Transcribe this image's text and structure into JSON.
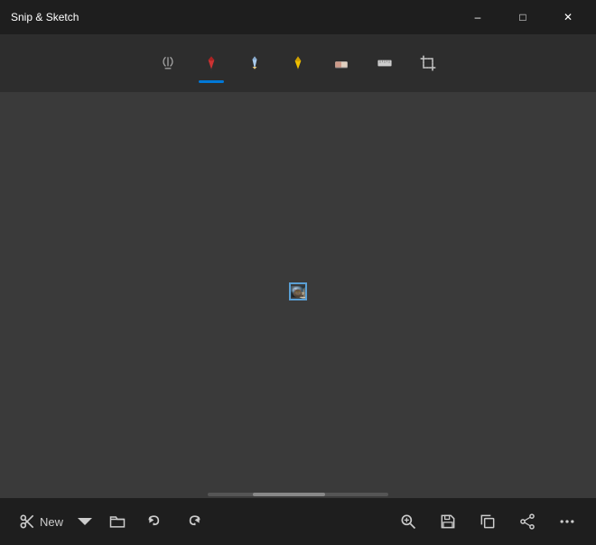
{
  "app": {
    "title": "Snip & Sketch",
    "colors": {
      "titlebar": "#1e1e1e",
      "toolbar": "#2d2d2d",
      "canvas_bg": "#3a3a3a",
      "bottombar": "#1e1e1e",
      "accent": "#0078d7"
    }
  },
  "titlebar": {
    "title": "Snip & Sketch",
    "minimize_label": "–",
    "maximize_label": "□",
    "close_label": "✕"
  },
  "toolbar": {
    "tools": [
      {
        "id": "touch-write",
        "label": "Touch Writing",
        "active": false
      },
      {
        "id": "ballpoint",
        "label": "Ballpoint Pen",
        "active": true
      },
      {
        "id": "pencil",
        "label": "Pencil",
        "active": false
      },
      {
        "id": "highlighter",
        "label": "Highlighter",
        "active": false
      },
      {
        "id": "eraser",
        "label": "Eraser",
        "active": false
      },
      {
        "id": "ruler",
        "label": "Ruler",
        "active": false
      },
      {
        "id": "crop",
        "label": "Crop",
        "active": false
      }
    ]
  },
  "bottombar": {
    "new_label": "New",
    "buttons": [
      {
        "id": "open",
        "label": "Open"
      },
      {
        "id": "undo",
        "label": "Undo"
      },
      {
        "id": "redo",
        "label": "Redo"
      },
      {
        "id": "zoom-in",
        "label": "Zoom In"
      },
      {
        "id": "save",
        "label": "Save"
      },
      {
        "id": "copy",
        "label": "Copy"
      },
      {
        "id": "share",
        "label": "Share"
      },
      {
        "id": "more",
        "label": "More"
      }
    ]
  }
}
